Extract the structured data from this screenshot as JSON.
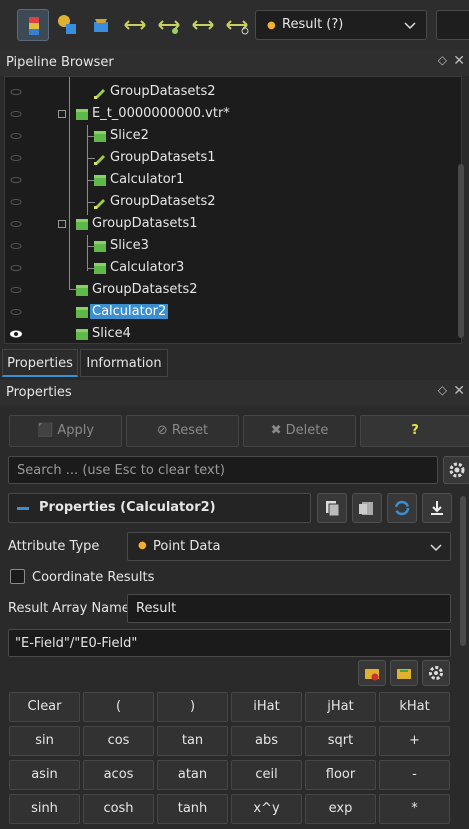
{
  "toolbar": {
    "result_combo": "Result (?)"
  },
  "pipeline": {
    "title": "Pipeline Browser",
    "items": [
      {
        "label": "GroupDatasets2"
      },
      {
        "label": "E_t_0000000000.vtr*"
      },
      {
        "label": "Slice2"
      },
      {
        "label": "GroupDatasets1"
      },
      {
        "label": "Calculator1"
      },
      {
        "label": "GroupDatasets2"
      },
      {
        "label": "GroupDatasets1"
      },
      {
        "label": "Slice3"
      },
      {
        "label": "Calculator3"
      },
      {
        "label": "GroupDatasets2"
      },
      {
        "label": "Calculator2"
      },
      {
        "label": "Slice4"
      }
    ]
  },
  "tabs": [
    {
      "label": "Properties"
    },
    {
      "label": "Information"
    }
  ],
  "properties": {
    "title": "Properties",
    "apply": "Apply",
    "reset": "Reset",
    "delete": "Delete",
    "help": "?",
    "search_placeholder": "Search ... (use Esc to clear text)",
    "section_title": "Properties (Calculator2)",
    "attribute_type_label": "Attribute Type",
    "attribute_type_value": "Point Data",
    "coordinate_results_label": "Coordinate Results",
    "result_array_name_label": "Result Array Name",
    "result_array_name_value": "Result",
    "expression": "\"E-Field\"/\"E0-Field\""
  },
  "calculator": {
    "rows": [
      [
        "Clear",
        "(",
        ")",
        "iHat",
        "jHat",
        "kHat"
      ],
      [
        "sin",
        "cos",
        "tan",
        "abs",
        "sqrt",
        "+"
      ],
      [
        "asin",
        "acos",
        "atan",
        "ceil",
        "floor",
        "-"
      ],
      [
        "sinh",
        "cosh",
        "tanh",
        "x^y",
        "exp",
        "*"
      ]
    ]
  },
  "colors": {
    "selection": "#3b8fd1",
    "cube_green": "#5fb848",
    "help_accent": "#e8e050"
  }
}
